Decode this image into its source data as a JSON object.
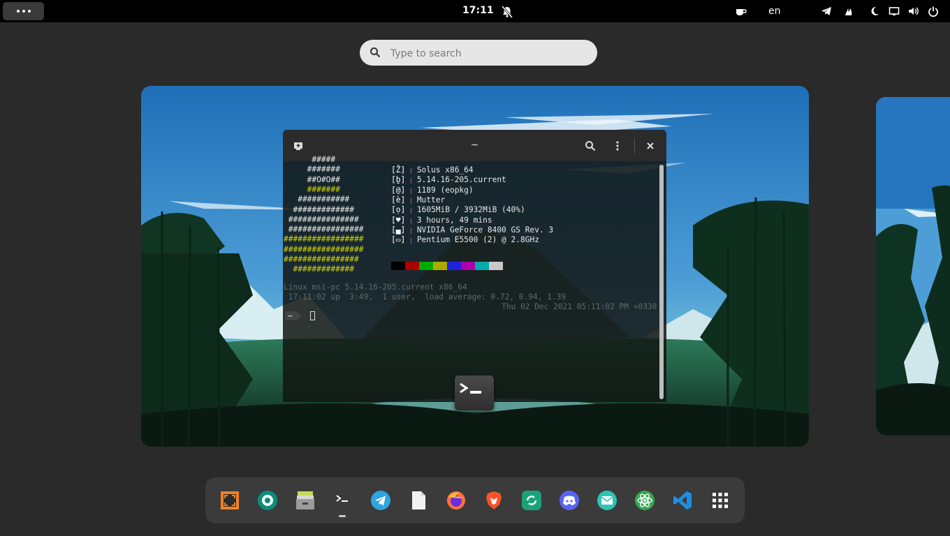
{
  "topbar": {
    "activities_icon": "dots-icon",
    "clock": "17:11",
    "notification_icon": "bell-muted-icon",
    "language": "en",
    "tray_icons": [
      "coffee-icon",
      "telegram-icon",
      "flame-icon",
      "moon-icon",
      "screen-icon",
      "volume-icon",
      "power-icon"
    ]
  },
  "search": {
    "placeholder": "Type to search"
  },
  "terminal": {
    "title": "~",
    "ascii_art": [
      "      #####",
      "     #######",
      "     ##O#O##",
      "     #######",
      "   ###########",
      "  #############",
      " ###############",
      " ################",
      "#################",
      "#################",
      "################",
      "  #############"
    ],
    "info": [
      {
        "icon": "[Ž]",
        "sep": "ꞁ",
        "value": "Solus x86_64"
      },
      {
        "icon": "[ḇ]",
        "sep": "ꞁ",
        "value": "5.14.16-205.current"
      },
      {
        "icon": "[@]",
        "sep": "ꞁ",
        "value": "1189 (eopkg)"
      },
      {
        "icon": "[è]",
        "sep": "ꞁ",
        "value": "Mutter"
      },
      {
        "icon": "[ọ]",
        "sep": "ꞁ",
        "value": "1605MiB / 3932MiB (40%)"
      },
      {
        "icon": "[♥]",
        "sep": "ꞁ",
        "value": "3 hours, 49 mins"
      },
      {
        "icon": "[▄]",
        "sep": "ꞁ",
        "value": "NVIDIA GeForce 8400 GS Rev. 3"
      },
      {
        "icon": "[▭]",
        "sep": "ꞁ",
        "value": "Pentium E5500 (2) @ 2.8GHz"
      }
    ],
    "palette": [
      "#000000",
      "#aa0000",
      "#00aa00",
      "#aaaa00",
      "#2222dd",
      "#aa00aa",
      "#00aaaa",
      "#c8c8c8"
    ],
    "uname": "Linux msi-pc 5.14.16-205.current x86_64",
    "uptime": " 17:11:02 up  3:49,  1 user,  load average: 0.72, 0.94, 1.39",
    "prompt_dir": "~",
    "date": "Thu 02 Dec 2021 05:11:02 PM +0330"
  },
  "dock": {
    "items": [
      {
        "name": "screenshot",
        "icon": "screenshot-icon"
      },
      {
        "name": "camera",
        "icon": "camera-aperture-icon"
      },
      {
        "name": "archive",
        "icon": "archive-icon"
      },
      {
        "name": "terminal",
        "icon": "terminal-icon"
      },
      {
        "name": "telegram",
        "icon": "telegram-icon"
      },
      {
        "name": "text-editor",
        "icon": "document-icon"
      },
      {
        "name": "firefox",
        "icon": "firefox-icon"
      },
      {
        "name": "brave",
        "icon": "brave-icon"
      },
      {
        "name": "sync",
        "icon": "sync-icon"
      },
      {
        "name": "discord",
        "icon": "discord-icon"
      },
      {
        "name": "mail",
        "icon": "mail-icon"
      },
      {
        "name": "atom",
        "icon": "atom-icon"
      },
      {
        "name": "vscode",
        "icon": "vscode-icon"
      },
      {
        "name": "app-grid",
        "icon": "app-grid-icon"
      }
    ]
  }
}
